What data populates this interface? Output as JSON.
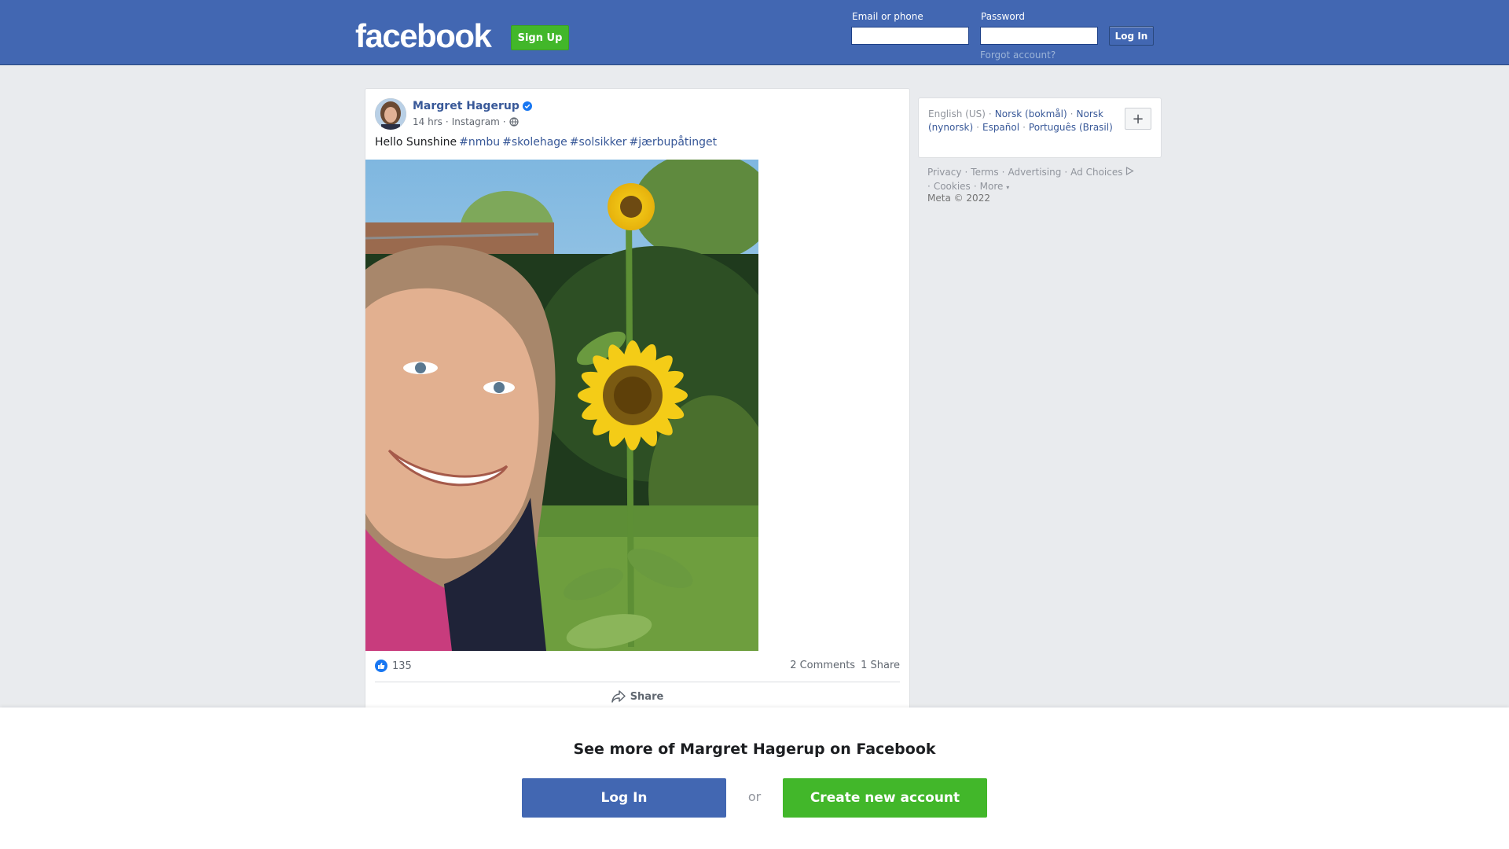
{
  "header": {
    "logo": "facebook",
    "signup_label": "Sign Up",
    "email_label": "Email or phone",
    "password_label": "Password",
    "email_value": "",
    "password_value": "",
    "login_label": "Log In",
    "forgot_label": "Forgot account?"
  },
  "post": {
    "author": "Margret Hagerup",
    "verified_icon": "verified-badge-icon",
    "time": "14 hrs",
    "source": "Instagram",
    "audience_icon": "globe-icon",
    "text": "Hello Sunshine",
    "hashtags": [
      "#nmbu",
      "#skolehage",
      "#solsikker",
      "#jærbupåtinget"
    ],
    "photo_icon": "selfie-with-sunflower-photo",
    "reaction_icon": "like-icon",
    "reaction_count": "135",
    "comments": "2 Comments",
    "shares": "1 Share",
    "share_label": "Share"
  },
  "sidebar": {
    "languages": {
      "current": "English (US)",
      "links": [
        "Norsk (bokmål)",
        "Norsk (nynorsk)",
        "Español",
        "Português (Brasil)"
      ]
    },
    "footer_links": [
      "Privacy",
      "Terms",
      "Advertising",
      "Ad Choices",
      "Cookies",
      "More"
    ],
    "copyright": "Meta © 2022"
  },
  "bottom": {
    "title": "See more of Margret Hagerup on Facebook",
    "login_label": "Log In",
    "or_label": "or",
    "create_label": "Create new account"
  },
  "colors": {
    "brand": "#4267b2",
    "green": "#42b72a",
    "link": "#385898",
    "background": "#e9ebee"
  }
}
